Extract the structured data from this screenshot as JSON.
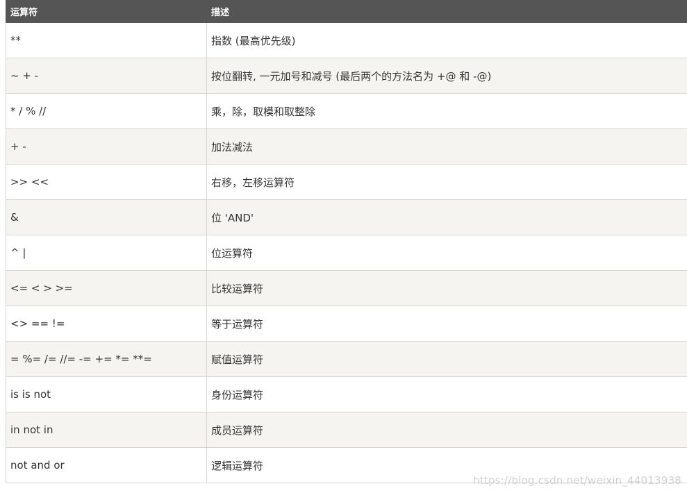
{
  "table": {
    "headers": [
      "运算符",
      "描述"
    ],
    "rows": [
      {
        "operator": "**",
        "description": "指数 (最高优先级)"
      },
      {
        "operator": "~ + -",
        "description": "按位翻转, 一元加号和减号 (最后两个的方法名为 +@ 和 -@)"
      },
      {
        "operator": "* / % //",
        "description": "乘，除，取模和取整除"
      },
      {
        "operator": "+ -",
        "description": "加法减法"
      },
      {
        "operator": ">> <<",
        "description": "右移，左移运算符"
      },
      {
        "operator": "&",
        "description": "位 'AND'"
      },
      {
        "operator": "^ |",
        "description": "位运算符"
      },
      {
        "operator": "<= < > >=",
        "description": "比较运算符"
      },
      {
        "operator": "<> == !=",
        "description": "等于运算符"
      },
      {
        "operator": "= %= /= //= -= += *= **=",
        "description": "赋值运算符"
      },
      {
        "operator": "is is not",
        "description": "身份运算符"
      },
      {
        "operator": "in not in",
        "description": "成员运算符"
      },
      {
        "operator": "not and or",
        "description": "逻辑运算符"
      }
    ]
  },
  "watermark": "https://blog.csdn.net/weixin_44013938",
  "colors": {
    "header_bg": "#555555",
    "header_text": "#ffffff",
    "row_alt_bg": "#f6f4f0",
    "border": "#d4d4d4"
  }
}
